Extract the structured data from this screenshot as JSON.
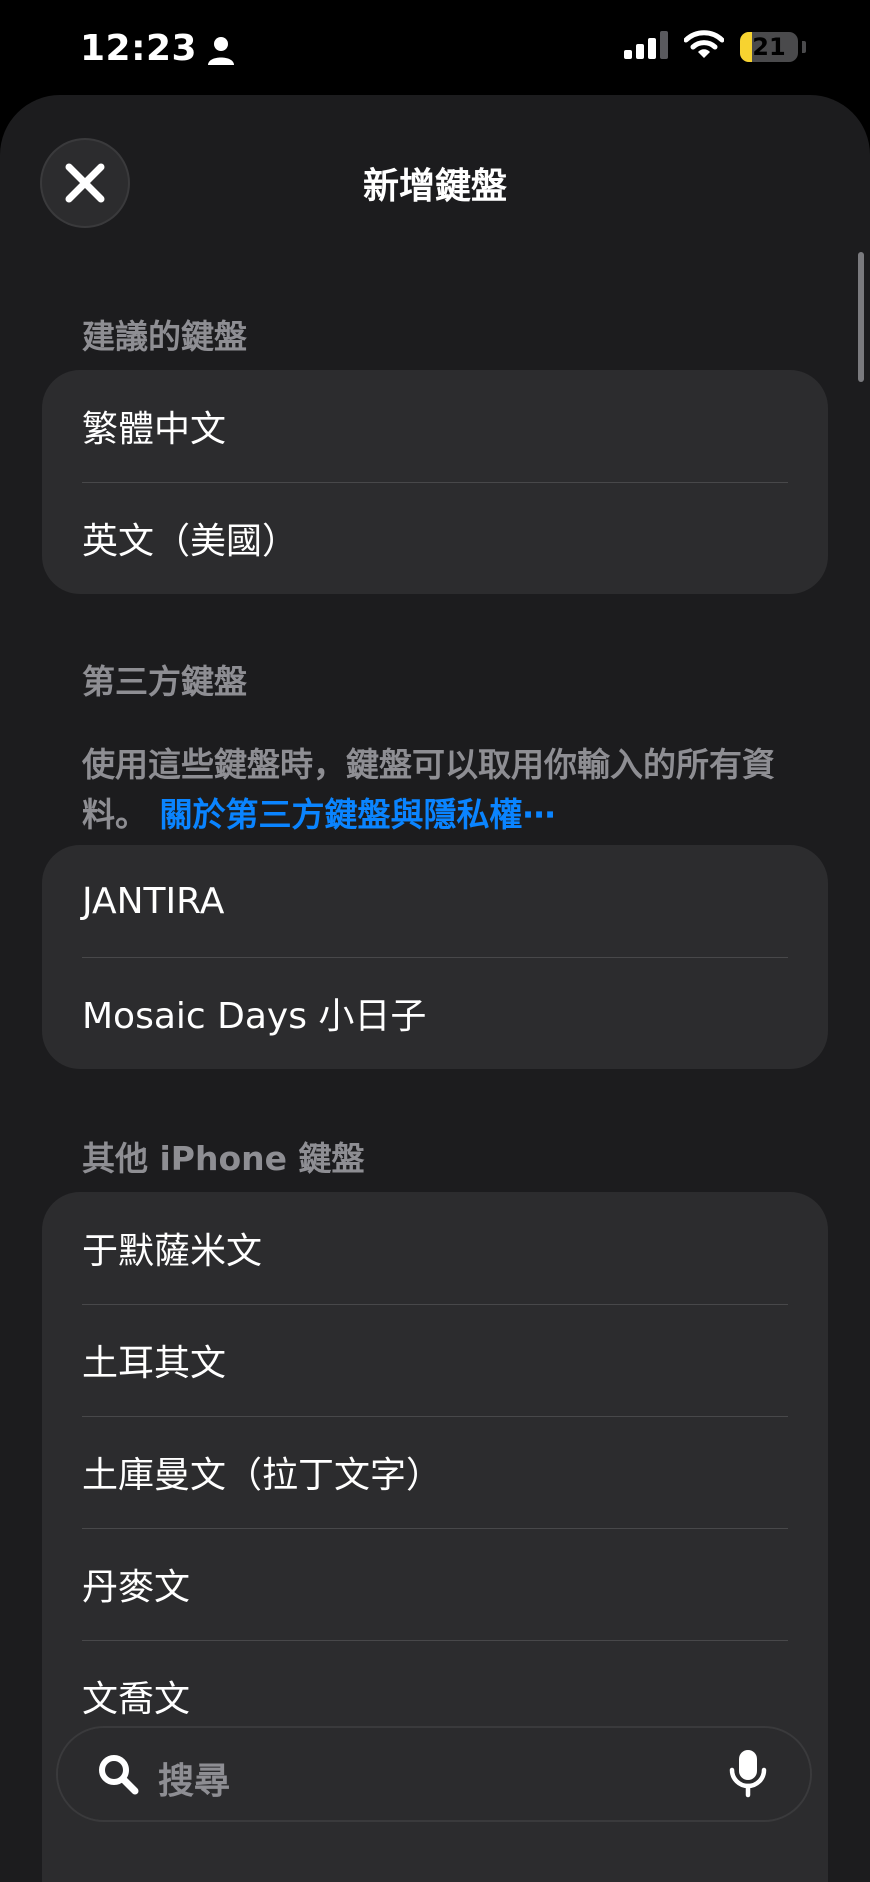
{
  "status_bar": {
    "time": "12:23",
    "battery_level": "21",
    "battery_percent": 21
  },
  "sheet": {
    "title": "新增鍵盤",
    "close_label": "close"
  },
  "sections": {
    "suggested": {
      "header": "建議的鍵盤",
      "items": [
        "繁體中文",
        "英文（美國）"
      ]
    },
    "third_party": {
      "header": "第三方鍵盤",
      "note": "使用這些鍵盤時，鍵盤可以取用你輸入的所有資料。",
      "link": "關於第三方鍵盤與隱私權⋯",
      "items": [
        "JANTIRA",
        "Mosaic Days 小日子"
      ]
    },
    "other": {
      "header": "其他 iPhone 鍵盤",
      "items": [
        "于默薩米文",
        "土耳其文",
        "土庫曼文（拉丁文字）",
        "丹麥文",
        "文喬文"
      ]
    }
  },
  "search": {
    "placeholder": "搜尋"
  },
  "colors": {
    "sheet_bg": "#1c1c1e",
    "group_bg": "#2c2c2e",
    "accent": "#0a84ff",
    "battery": "#f7d330",
    "secondary_text": "#8e8e93"
  },
  "icons": [
    "person-icon",
    "signal-icon",
    "wifi-icon",
    "battery-icon",
    "close-icon",
    "search-icon",
    "microphone-icon"
  ]
}
